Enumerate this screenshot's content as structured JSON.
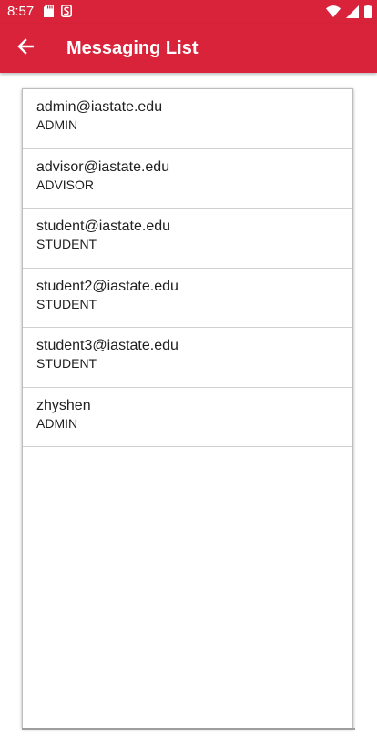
{
  "status_bar": {
    "time": "8:57",
    "icons": [
      "sd-card-icon",
      "s-notification-icon",
      "wifi-icon",
      "signal-icon",
      "battery-icon"
    ]
  },
  "app_bar": {
    "title": "Messaging List",
    "back_icon": "back-arrow-icon",
    "color": "#d9233a"
  },
  "messaging_list": {
    "items": [
      {
        "email": "admin@iastate.edu",
        "role": "ADMIN"
      },
      {
        "email": "advisor@iastate.edu",
        "role": "ADVISOR"
      },
      {
        "email": "student@iastate.edu",
        "role": "STUDENT"
      },
      {
        "email": "student2@iastate.edu",
        "role": "STUDENT"
      },
      {
        "email": "student3@iastate.edu",
        "role": "STUDENT"
      },
      {
        "email": "zhyshen",
        "role": "ADMIN"
      }
    ]
  }
}
